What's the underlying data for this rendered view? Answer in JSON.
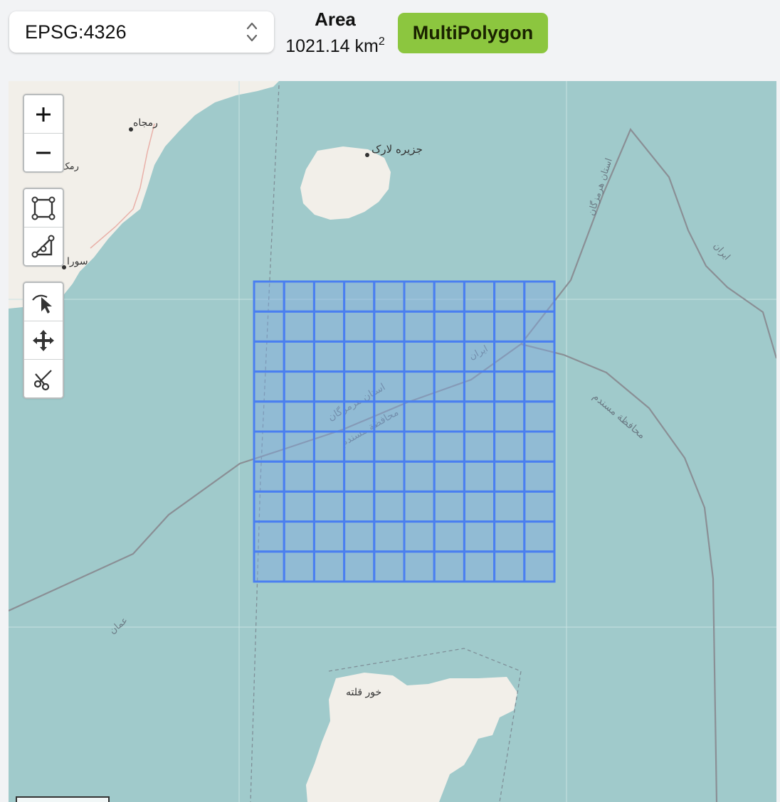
{
  "toolbar": {
    "crs_value": "EPSG:4326",
    "area_label": "Area",
    "area_value": "1021.14 km",
    "area_unit_sup": "2",
    "geometry_type": "MultiPolygon"
  },
  "colors": {
    "badge_green": "#8cc63f",
    "water": "#a0cacb",
    "land": "#f2efe9",
    "grid_stroke": "#4a7ff0",
    "grid_fill": "#7fa8e0"
  },
  "map_controls": {
    "zoom": [
      "zoom-in-button",
      "zoom-out-button"
    ],
    "draw": [
      "draw-rectangle-button",
      "draw-polygon-button"
    ],
    "edit": [
      "select-button",
      "move-button",
      "cut-button"
    ]
  },
  "map_labels": {
    "ramjah": "رمجاه",
    "rama": "رمک",
    "sura": "سورا",
    "lark_island": "جزیره لارک",
    "hormozgan_province": "استان هرمزگان",
    "iran_right": "ایران",
    "iran_center": "ایران",
    "hormozgan_center": "استان هرمزگان",
    "musandam_center": "محافظة مسندم",
    "musandam_right": "محافظة مسندم",
    "oman": "عمان",
    "khawr": "خور قلته"
  },
  "grid": {
    "rows": 10,
    "cols": 10
  }
}
